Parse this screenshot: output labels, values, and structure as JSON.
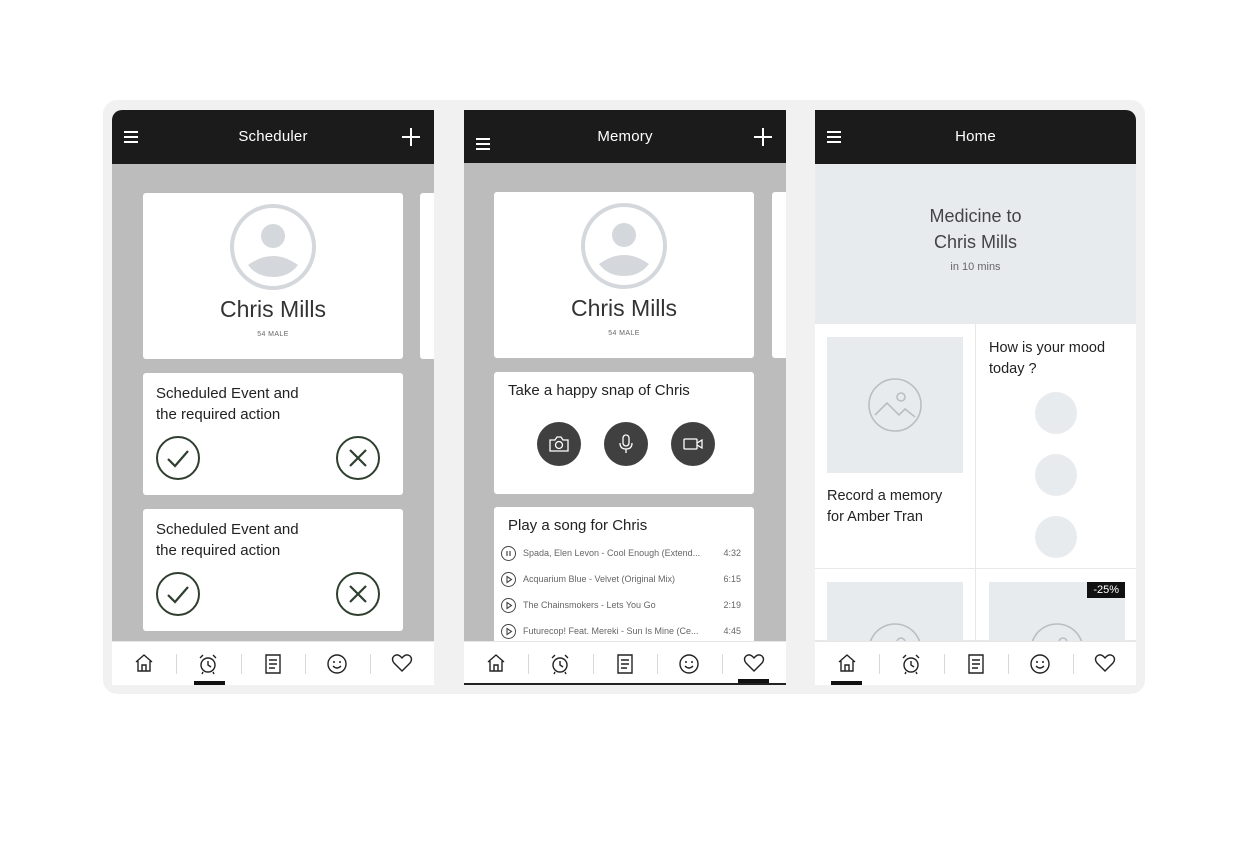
{
  "screens": {
    "scheduler": {
      "title": "Scheduler",
      "profile": {
        "name": "Chris Mills",
        "sub": "54 MALE"
      },
      "events": [
        {
          "line1": "Scheduled Event and",
          "line2": "the required action"
        },
        {
          "line1": "Scheduled Event and",
          "line2": "the required action"
        }
      ],
      "active_tab": "alarm"
    },
    "memory": {
      "title": "Memory",
      "profile": {
        "name": "Chris Mills",
        "sub": "54 MALE"
      },
      "snap_title": "Take a happy snap of Chris",
      "song_title": "Play a song for Chris",
      "songs": [
        {
          "title": "Spada, Elen Levon - Cool Enough (Extend...",
          "duration": "4:32",
          "state": "pause"
        },
        {
          "title": "Acquarium Blue - Velvet (Original Mix)",
          "duration": "6:15",
          "state": "play"
        },
        {
          "title": "The Chainsmokers - Lets You Go",
          "duration": "2:19",
          "state": "play"
        },
        {
          "title": "Futurecop! Feat. Mereki - Sun Is Mine (Ce...",
          "duration": "4:45",
          "state": "play"
        }
      ],
      "active_tab": "heart"
    },
    "home": {
      "title": "Home",
      "banner": {
        "line1": "Medicine to",
        "line2": "Chris Mills",
        "sub": "in 10 mins"
      },
      "record_memory": {
        "line1": "Record a memory",
        "line2": "for Amber Tran"
      },
      "mood": {
        "line1": "How is your mood",
        "line2": "today ?"
      },
      "discount": "-25%",
      "active_tab": "home"
    }
  },
  "tabs": [
    "home-icon",
    "alarm-icon",
    "notes-icon",
    "smiley-icon",
    "heart-icon"
  ],
  "colors": {
    "topbar": "#1b1b1b",
    "content_bg": "#bcbcbc",
    "placeholder": "#e8ebee",
    "check": "#2f3f2f",
    "media_button": "#404040"
  }
}
